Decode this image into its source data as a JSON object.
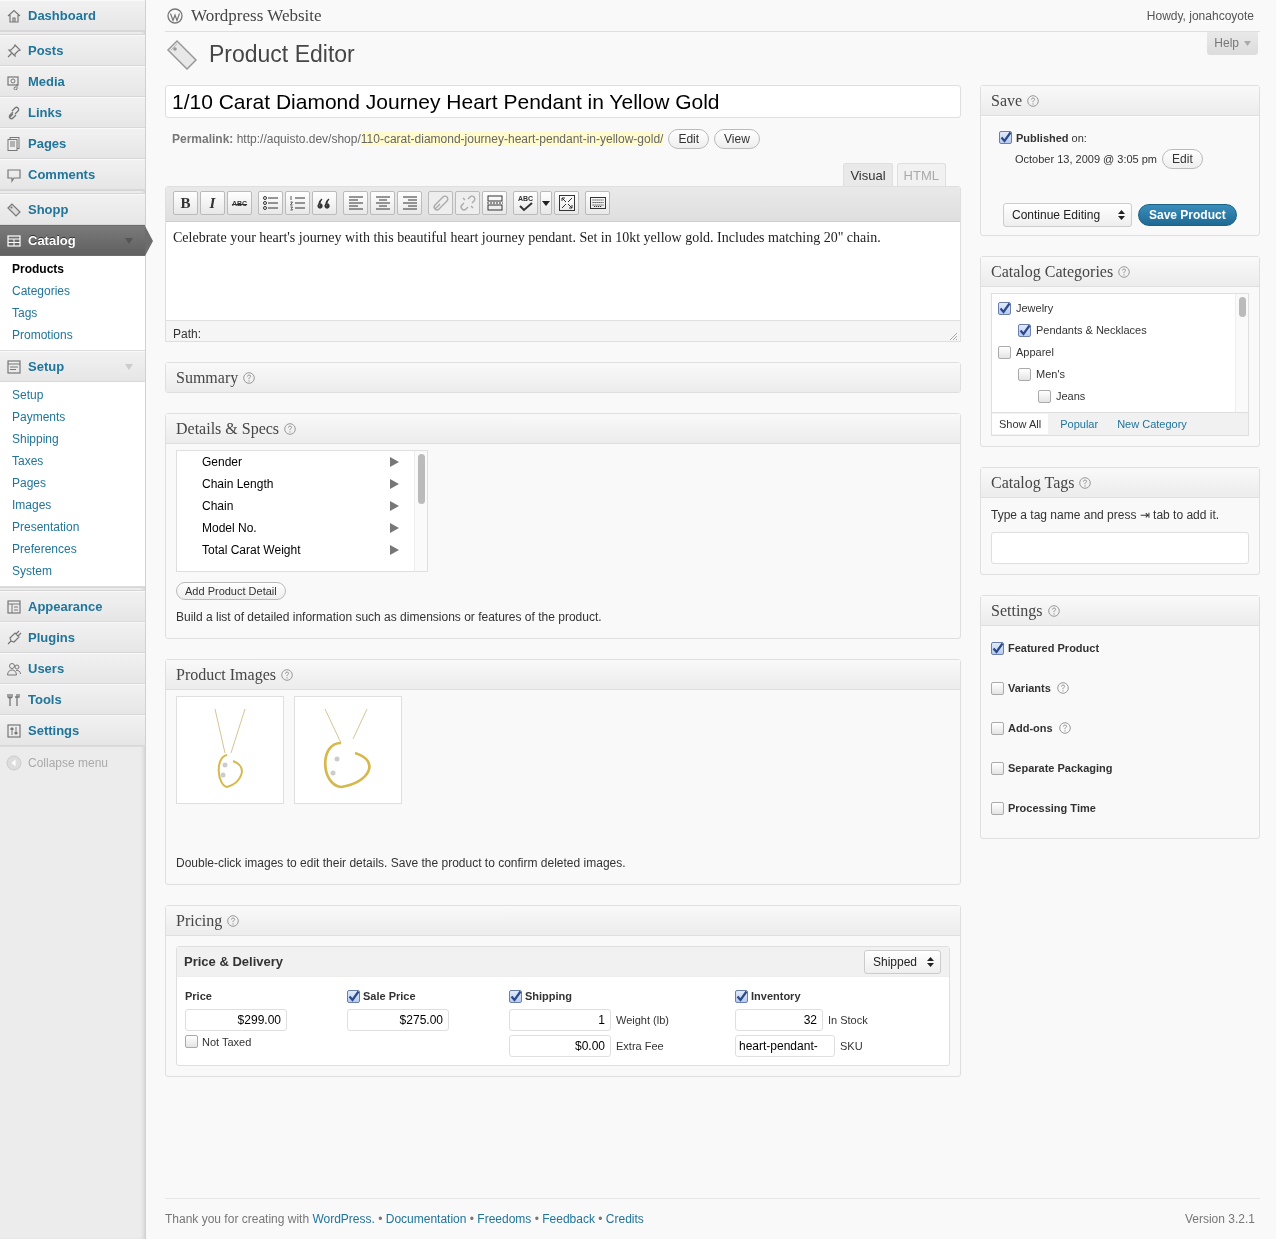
{
  "header": {
    "site_title": "Wordpress Website",
    "greeting": "Howdy, jonahcoyote",
    "help": "Help"
  },
  "sidebar": {
    "groups": [
      [
        {
          "label": "Dashboard",
          "selected": false
        }
      ],
      [
        {
          "label": "Posts",
          "selected": false
        },
        {
          "label": "Media",
          "selected": false
        },
        {
          "label": "Links",
          "selected": false
        },
        {
          "label": "Pages",
          "selected": false
        },
        {
          "label": "Comments",
          "selected": false
        }
      ],
      [
        {
          "label": "Shopp",
          "selected": false
        },
        {
          "label": "Catalog",
          "selected": true,
          "expanded": true,
          "children": [
            {
              "label": "Products",
              "selected": true
            },
            {
              "label": "Categories",
              "selected": false
            },
            {
              "label": "Tags",
              "selected": false
            },
            {
              "label": "Promotions",
              "selected": false
            }
          ]
        },
        {
          "label": "Setup",
          "selected": false,
          "expanded": true,
          "children": [
            {
              "label": "Setup",
              "selected": false
            },
            {
              "label": "Payments",
              "selected": false
            },
            {
              "label": "Shipping",
              "selected": false
            },
            {
              "label": "Taxes",
              "selected": false
            },
            {
              "label": "Pages",
              "selected": false
            },
            {
              "label": "Images",
              "selected": false
            },
            {
              "label": "Presentation",
              "selected": false
            },
            {
              "label": "Preferences",
              "selected": false
            },
            {
              "label": "System",
              "selected": false
            }
          ]
        }
      ],
      [
        {
          "label": "Appearance",
          "selected": false
        },
        {
          "label": "Plugins",
          "selected": false
        },
        {
          "label": "Users",
          "selected": false
        },
        {
          "label": "Tools",
          "selected": false
        },
        {
          "label": "Settings",
          "selected": false
        }
      ]
    ],
    "collapse": "Collapse menu"
  },
  "page_title": "Product Editor",
  "editor": {
    "title_value": "1/10 Carat Diamond Journey Heart Pendant in Yellow Gold",
    "permalink": {
      "label": "Permalink:",
      "base": "http://aquisto.dev/shop/",
      "slug": "110-carat-diamond-journey-heart-pendant-in-yellow-gold/",
      "buttons": [
        "Edit",
        "View"
      ]
    },
    "tabs": [
      {
        "label": "Visual",
        "selected": true
      },
      {
        "label": "HTML",
        "selected": false
      }
    ],
    "toolbar": [
      [
        {
          "label": "B",
          "disabled": false
        },
        {
          "label": "I",
          "disabled": false
        },
        {
          "label": "ABC",
          "disabled": false
        }
      ],
      [
        {
          "disabled": false
        },
        {
          "disabled": false
        },
        {
          "disabled": false
        }
      ],
      [
        {
          "disabled": false
        },
        {
          "disabled": false
        },
        {
          "disabled": false
        }
      ],
      [
        {
          "disabled": true
        },
        {
          "disabled": true
        },
        {
          "disabled": false
        }
      ],
      [
        {
          "label": "ABC",
          "disabled": false
        },
        {
          "disabled": false
        },
        {
          "disabled": false
        }
      ],
      [
        {
          "disabled": false
        }
      ]
    ],
    "content": "Celebrate your heart's journey with this beautiful heart journey pendant. Set in 10kt yellow gold. Includes matching 20\" chain.",
    "path_label": "Path:"
  },
  "summary": {
    "title": "Summary"
  },
  "details": {
    "title": "Details & Specs",
    "items": [
      "Gender",
      "Chain Length",
      "Chain",
      "Model No.",
      "Total Carat Weight"
    ],
    "button": "Add Product Detail",
    "note": "Build a list of detailed information such as dimensions or features of the product."
  },
  "images": {
    "title": "Product Images",
    "note": "Double-click images to edit their details. Save the product to confirm deleted images."
  },
  "pricing": {
    "title": "Pricing",
    "panel_title": "Price & Delivery",
    "type_select": "Shipped",
    "columns": [
      {
        "kind": "plain",
        "label": "Price",
        "fields": [
          {
            "value": "$299.00"
          }
        ],
        "option": {
          "label": "Not Taxed",
          "checked": false
        }
      },
      {
        "kind": "toggle",
        "label": "Sale Price",
        "checked": true,
        "fields": [
          {
            "value": "$275.00"
          }
        ]
      },
      {
        "kind": "toggle",
        "label": "Shipping",
        "checked": true,
        "fields": [
          {
            "value": "1",
            "label": "Weight (lb)"
          },
          {
            "value": "$0.00",
            "label": "Extra Fee"
          }
        ]
      },
      {
        "kind": "toggle",
        "label": "Inventory",
        "checked": true,
        "fields": [
          {
            "value": "32",
            "label": "In Stock"
          },
          {
            "value": "heart-pendant-",
            "label": "SKU"
          }
        ]
      }
    ]
  },
  "save": {
    "title": "Save",
    "published": {
      "label": "**Published** on:",
      "checked": true
    },
    "date": "October 13, 2009 @ 3:05 pm",
    "edit": "Edit",
    "after_save": "Continue Editing",
    "save_button": "Save Product"
  },
  "categories": {
    "title": "Catalog Categories",
    "tree": [
      {
        "label": "Jewelry",
        "checked": true,
        "children": [
          {
            "label": "Pendants & Necklaces",
            "checked": true
          }
        ]
      },
      {
        "label": "Apparel",
        "checked": false,
        "children": [
          {
            "label": "Men's",
            "checked": false,
            "children": [
              {
                "label": "Jeans",
                "checked": false
              }
            ]
          }
        ]
      }
    ],
    "tabs": [
      {
        "label": "Show All",
        "selected": true
      },
      {
        "label": "Popular",
        "selected": false
      }
    ],
    "new_link": "New Category"
  },
  "tags": {
    "title": "Catalog Tags",
    "hint": "Type a tag name and press ⇥ tab to add it."
  },
  "settings": {
    "title": "Settings",
    "options": [
      {
        "label": "Featured Product",
        "checked": true,
        "help": false
      },
      {
        "label": "Variants",
        "checked": false,
        "help": true
      },
      {
        "label": "Add-ons",
        "checked": false,
        "help": true
      },
      {
        "label": "Separate Packaging",
        "checked": false,
        "help": false
      },
      {
        "label": "Processing Time",
        "checked": false,
        "help": false
      }
    ]
  },
  "footer": {
    "text": "Thank you for creating with",
    "links": [
      "WordPress.",
      "Documentation",
      "Freedoms",
      "Feedback",
      "Credits"
    ],
    "separator": "•",
    "version": "Version 3.2.1"
  }
}
